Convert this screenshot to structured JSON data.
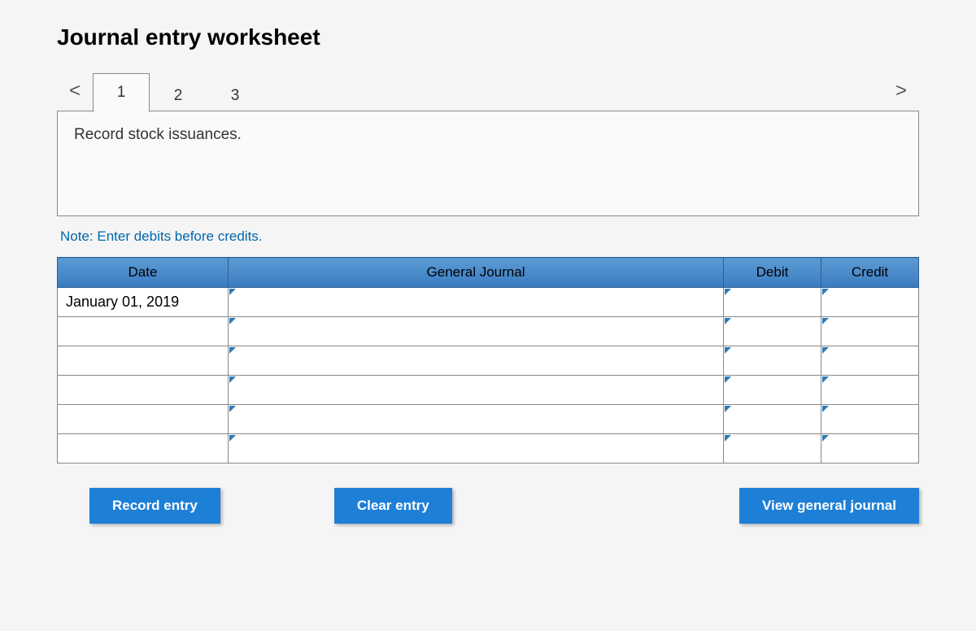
{
  "title": "Journal entry worksheet",
  "nav": {
    "prev": "<",
    "next": ">"
  },
  "tabs": [
    {
      "label": "1",
      "active": true
    },
    {
      "label": "2",
      "active": false
    },
    {
      "label": "3",
      "active": false
    }
  ],
  "description": "Record stock issuances.",
  "note": "Note: Enter debits before credits.",
  "table": {
    "headers": {
      "date": "Date",
      "journal": "General Journal",
      "debit": "Debit",
      "credit": "Credit"
    },
    "rows": [
      {
        "date": "January 01, 2019",
        "journal": "",
        "debit": "",
        "credit": ""
      },
      {
        "date": "",
        "journal": "",
        "debit": "",
        "credit": ""
      },
      {
        "date": "",
        "journal": "",
        "debit": "",
        "credit": ""
      },
      {
        "date": "",
        "journal": "",
        "debit": "",
        "credit": ""
      },
      {
        "date": "",
        "journal": "",
        "debit": "",
        "credit": ""
      },
      {
        "date": "",
        "journal": "",
        "debit": "",
        "credit": ""
      }
    ]
  },
  "buttons": {
    "record": "Record entry",
    "clear": "Clear entry",
    "view": "View general journal"
  }
}
